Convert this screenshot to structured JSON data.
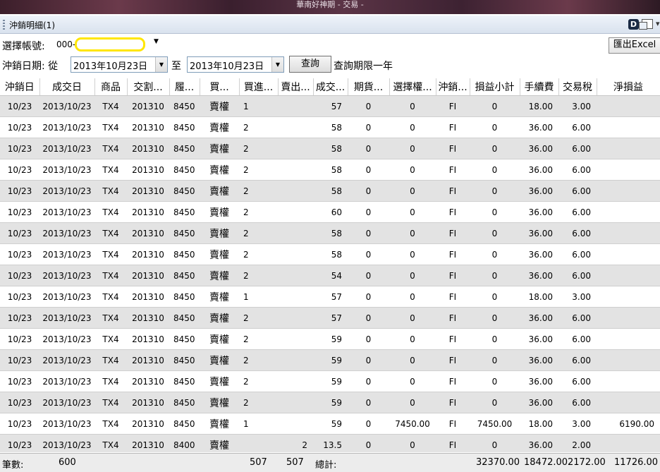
{
  "window": {
    "title": "華南好神期 - 交易 -"
  },
  "panel": {
    "title": "沖銷明細(1)"
  },
  "account": {
    "label": "選擇帳號:",
    "value": "000-"
  },
  "export_button": "匯出Excel",
  "date_filter": {
    "label": "沖銷日期: 從",
    "from": "2013年10月23日",
    "to_label": "至",
    "to": "2013年10月23日",
    "query_button": "查詢",
    "limit_text": "查詢期限一年"
  },
  "table": {
    "columns": [
      "沖銷日",
      "成交日",
      "商品",
      "交割...",
      "履...",
      "買...",
      "買進...",
      "賣出...",
      "成交...",
      "期貨...",
      "選擇權...",
      "沖銷...",
      "損益小計",
      "手續費",
      "交易稅",
      "淨損益"
    ],
    "rows": [
      [
        "10/23",
        "2013/10/23",
        "TX4",
        "201310",
        "8450",
        "賣權",
        "1",
        "",
        "57",
        "0",
        "0",
        "FI",
        "0",
        "18.00",
        "3.00",
        ""
      ],
      [
        "10/23",
        "2013/10/23",
        "TX4",
        "201310",
        "8450",
        "賣權",
        "2",
        "",
        "58",
        "0",
        "0",
        "FI",
        "0",
        "36.00",
        "6.00",
        ""
      ],
      [
        "10/23",
        "2013/10/23",
        "TX4",
        "201310",
        "8450",
        "賣權",
        "2",
        "",
        "58",
        "0",
        "0",
        "FI",
        "0",
        "36.00",
        "6.00",
        ""
      ],
      [
        "10/23",
        "2013/10/23",
        "TX4",
        "201310",
        "8450",
        "賣權",
        "2",
        "",
        "58",
        "0",
        "0",
        "FI",
        "0",
        "36.00",
        "6.00",
        ""
      ],
      [
        "10/23",
        "2013/10/23",
        "TX4",
        "201310",
        "8450",
        "賣權",
        "2",
        "",
        "58",
        "0",
        "0",
        "FI",
        "0",
        "36.00",
        "6.00",
        ""
      ],
      [
        "10/23",
        "2013/10/23",
        "TX4",
        "201310",
        "8450",
        "賣權",
        "2",
        "",
        "60",
        "0",
        "0",
        "FI",
        "0",
        "36.00",
        "6.00",
        ""
      ],
      [
        "10/23",
        "2013/10/23",
        "TX4",
        "201310",
        "8450",
        "賣權",
        "2",
        "",
        "58",
        "0",
        "0",
        "FI",
        "0",
        "36.00",
        "6.00",
        ""
      ],
      [
        "10/23",
        "2013/10/23",
        "TX4",
        "201310",
        "8450",
        "賣權",
        "2",
        "",
        "58",
        "0",
        "0",
        "FI",
        "0",
        "36.00",
        "6.00",
        ""
      ],
      [
        "10/23",
        "2013/10/23",
        "TX4",
        "201310",
        "8450",
        "賣權",
        "2",
        "",
        "54",
        "0",
        "0",
        "FI",
        "0",
        "36.00",
        "6.00",
        ""
      ],
      [
        "10/23",
        "2013/10/23",
        "TX4",
        "201310",
        "8450",
        "賣權",
        "1",
        "",
        "57",
        "0",
        "0",
        "FI",
        "0",
        "18.00",
        "3.00",
        ""
      ],
      [
        "10/23",
        "2013/10/23",
        "TX4",
        "201310",
        "8450",
        "賣權",
        "2",
        "",
        "57",
        "0",
        "0",
        "FI",
        "0",
        "36.00",
        "6.00",
        ""
      ],
      [
        "10/23",
        "2013/10/23",
        "TX4",
        "201310",
        "8450",
        "賣權",
        "2",
        "",
        "59",
        "0",
        "0",
        "FI",
        "0",
        "36.00",
        "6.00",
        ""
      ],
      [
        "10/23",
        "2013/10/23",
        "TX4",
        "201310",
        "8450",
        "賣權",
        "2",
        "",
        "59",
        "0",
        "0",
        "FI",
        "0",
        "36.00",
        "6.00",
        ""
      ],
      [
        "10/23",
        "2013/10/23",
        "TX4",
        "201310",
        "8450",
        "賣權",
        "2",
        "",
        "59",
        "0",
        "0",
        "FI",
        "0",
        "36.00",
        "6.00",
        ""
      ],
      [
        "10/23",
        "2013/10/23",
        "TX4",
        "201310",
        "8450",
        "賣權",
        "2",
        "",
        "59",
        "0",
        "0",
        "FI",
        "0",
        "36.00",
        "6.00",
        ""
      ],
      [
        "10/23",
        "2013/10/23",
        "TX4",
        "201310",
        "8450",
        "賣權",
        "1",
        "",
        "59",
        "0",
        "7450.00",
        "FI",
        "7450.00",
        "18.00",
        "3.00",
        "6190.00"
      ],
      [
        "10/23",
        "2013/10/23",
        "TX4",
        "201310",
        "8400",
        "賣權",
        "",
        "2",
        "13.5",
        "0",
        "0",
        "FI",
        "0",
        "36.00",
        "2.00",
        ""
      ]
    ]
  },
  "footer": {
    "count_label": "筆數:",
    "count": "600",
    "buy_total": "507",
    "sell_total": "507",
    "total_label": "總計:",
    "pnl_total": "32370.00",
    "fee_total": "18472.00",
    "tax_total": "2172.00",
    "net_total": "11726.00"
  }
}
